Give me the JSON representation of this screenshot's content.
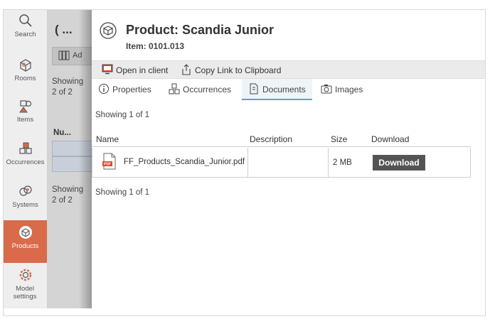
{
  "nav": {
    "items": [
      {
        "label": "Search",
        "icon": "search-icon"
      },
      {
        "label": "Rooms",
        "icon": "rooms-icon"
      },
      {
        "label": "Items",
        "icon": "items-icon"
      },
      {
        "label": "Occurrences",
        "icon": "occurrences-icon"
      },
      {
        "label": "Systems",
        "icon": "systems-icon"
      },
      {
        "label": "Products",
        "icon": "products-icon"
      },
      {
        "label": "Model settings",
        "icon": "model-settings-icon"
      }
    ],
    "active": "Products",
    "active_color": "#d96a4a"
  },
  "middle": {
    "title": "( ...",
    "add_label": "Ad",
    "showing_top": "Showing\n2 of 2",
    "column": "Nu...",
    "showing_bottom": "Showing\n2 of 2"
  },
  "product": {
    "title": "Product: Scandia Junior",
    "item": "Item: 0101.013"
  },
  "toolbar": {
    "open_label": "Open in client",
    "copy_label": "Copy Link to Clipboard"
  },
  "tabs": [
    {
      "label": "Properties",
      "icon": "info-icon"
    },
    {
      "label": "Occurrences",
      "icon": "occurrences-icon"
    },
    {
      "label": "Documents",
      "icon": "document-icon",
      "active": true
    },
    {
      "label": "Images",
      "icon": "camera-icon"
    }
  ],
  "documents": {
    "showing_top": "Showing 1 of 1",
    "showing_bottom": "Showing 1 of 1",
    "columns": {
      "name": "Name",
      "description": "Description",
      "size": "Size",
      "download": "Download"
    },
    "rows": [
      {
        "name": "FF_Products_Scandia_Junior.pdf",
        "description": "",
        "size": "2 MB",
        "download_label": "Download"
      }
    ]
  }
}
